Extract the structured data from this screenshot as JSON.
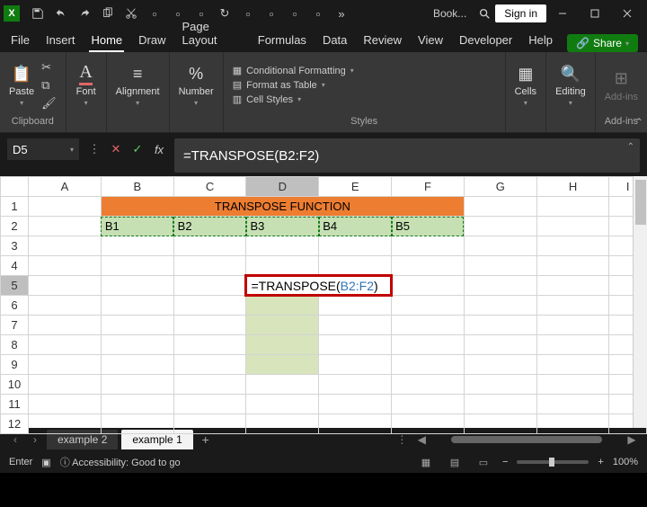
{
  "titlebar": {
    "app_abbrev": "X",
    "doc_name": "Book...",
    "signin": "Sign in"
  },
  "menu": {
    "file": "File",
    "insert": "Insert",
    "home": "Home",
    "draw": "Draw",
    "page_layout": "Page Layout",
    "formulas": "Formulas",
    "data": "Data",
    "review": "Review",
    "view": "View",
    "developer": "Developer",
    "help": "Help",
    "share": "Share"
  },
  "ribbon": {
    "clipboard": {
      "paste": "Paste",
      "label": "Clipboard"
    },
    "font": {
      "label": "Font"
    },
    "alignment": {
      "label": "Alignment"
    },
    "number": {
      "label": "Number"
    },
    "styles": {
      "conditional_formatting": "Conditional Formatting",
      "format_as_table": "Format as Table",
      "cell_styles": "Cell Styles",
      "label": "Styles"
    },
    "cells": {
      "label": "Cells"
    },
    "editing": {
      "label": "Editing"
    },
    "addins": {
      "label": "Add-ins"
    }
  },
  "formula_bar": {
    "name_box": "D5",
    "formula": "=TRANSPOSE(B2:F2)",
    "cell_formula_prefix": "=TRANSPOSE(",
    "cell_formula_ref": "B2:F2",
    "cell_formula_suffix": ")"
  },
  "grid": {
    "cols": [
      "A",
      "B",
      "C",
      "D",
      "E",
      "F",
      "G",
      "H",
      "I"
    ],
    "rows": [
      "1",
      "2",
      "3",
      "4",
      "5",
      "6",
      "7",
      "8",
      "9",
      "10",
      "11",
      "12"
    ],
    "title_merge": "TRANSPOSE FUNCTION",
    "row2": {
      "B": "B1",
      "C": "B2",
      "D": "B3",
      "E": "B4",
      "F": "B5"
    }
  },
  "sheets": {
    "prev": "‹",
    "next": "›",
    "inactive": "example 2",
    "active": "example 1",
    "add": "+",
    "more": "⋮"
  },
  "status": {
    "mode": "Enter",
    "accessibility": "Accessibility: Good to go",
    "zoom": "100%"
  }
}
